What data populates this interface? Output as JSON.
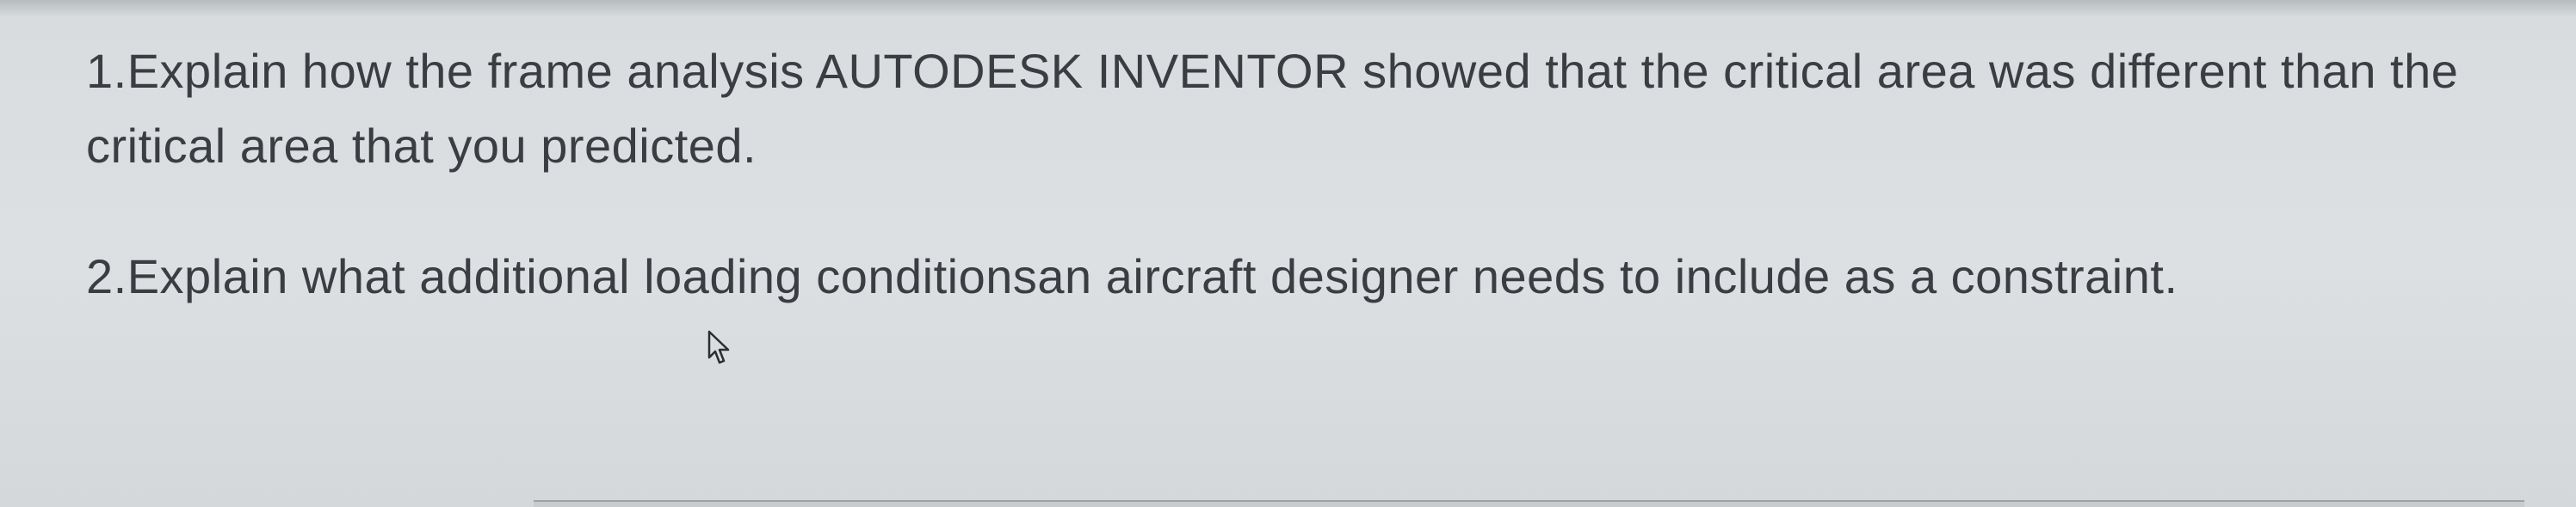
{
  "questions": {
    "q1": {
      "number": "1.",
      "text": "Explain how the frame analysis AUTODESK INVENTOR showed that the critical area was different than the critical area that you predicted."
    },
    "q2": {
      "number": "2.",
      "text": "Explain what additional loading conditionsan aircraft designer needs to include as a constraint."
    }
  }
}
